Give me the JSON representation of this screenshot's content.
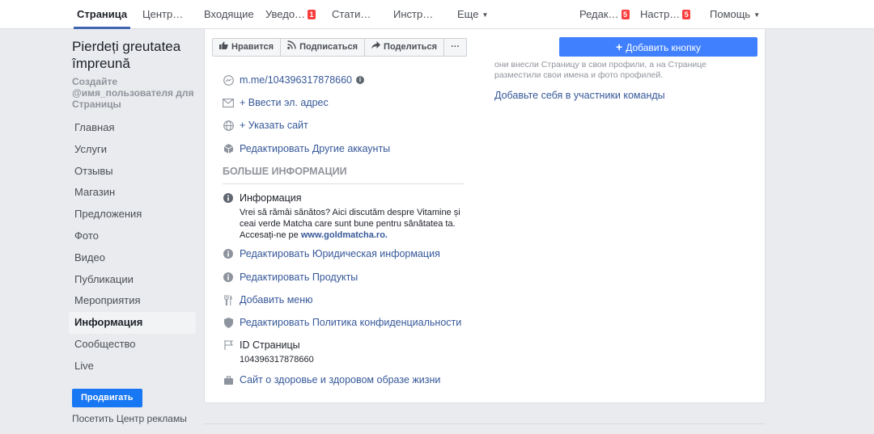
{
  "topnav": {
    "tabs": [
      {
        "label": "Страница",
        "active": true
      },
      {
        "label": "Центр…"
      },
      {
        "label": "Входящие"
      },
      {
        "label": "Уведо…",
        "badge": "1"
      },
      {
        "label": "Стати…"
      },
      {
        "label": "Инстр…"
      },
      {
        "label": "Еще"
      },
      {
        "label": "Редак…",
        "badge": "5"
      },
      {
        "label": "Настр…",
        "badge": "5"
      },
      {
        "label": "Помощь"
      }
    ]
  },
  "page": {
    "name": "Pierdeți greutatea împreună",
    "username_prompt": "Создайте @имя_пользователя для Страницы"
  },
  "leftnav": {
    "items": [
      "Главная",
      "Услуги",
      "Отзывы",
      "Магазин",
      "Предложения",
      "Фото",
      "Видео",
      "Публикации",
      "Мероприятия",
      "Информация",
      "Сообщество",
      "Live"
    ],
    "active_index": 9
  },
  "promote_label": "Продвигать",
  "ads_center_label": "Посетить Центр рекламы",
  "actions": {
    "like": "Нравится",
    "subscribe": "Подписаться",
    "share": "Поделиться",
    "more": "···"
  },
  "add_button_label": "Добавить кнопку",
  "contact": {
    "messenger": "m.me/104396317878660",
    "email": "+ Ввести эл. адрес",
    "website": "+ Указать сайт",
    "other_accounts": "Редактировать Другие аккаунты"
  },
  "more_info": {
    "heading": "БОЛЬШЕ ИНФОРМАЦИИ",
    "about_title": "Информация",
    "about_text": "Vrei să rămâi sănătos? Aici discutăm despre Vitamine și ceai verde Matcha care sunt bune pentru sănătatea ta. Accesați-ne pe ",
    "about_link": "www.goldmatcha.ro.",
    "legal": "Редактировать Юридическая информация",
    "products": "Редактировать Продукты",
    "menu": "Добавить меню",
    "privacy": "Редактировать Политика конфиденциальности",
    "page_id_label": "ID Страницы",
    "page_id_value": "104396317878660",
    "category": "Сайт о здоровье и здоровом образе жизни"
  },
  "team": {
    "faded_text": "они внесли Страницу в свои профили, а на Странице разместили свои имена и фото профилей.",
    "add_self_link": "Добавьте себя в участники команды"
  },
  "colors": {
    "accent": "#4267b2",
    "add_button": "#4080ff",
    "promote": "#1877f2",
    "badge": "#fa3e3e",
    "link": "#365899"
  }
}
